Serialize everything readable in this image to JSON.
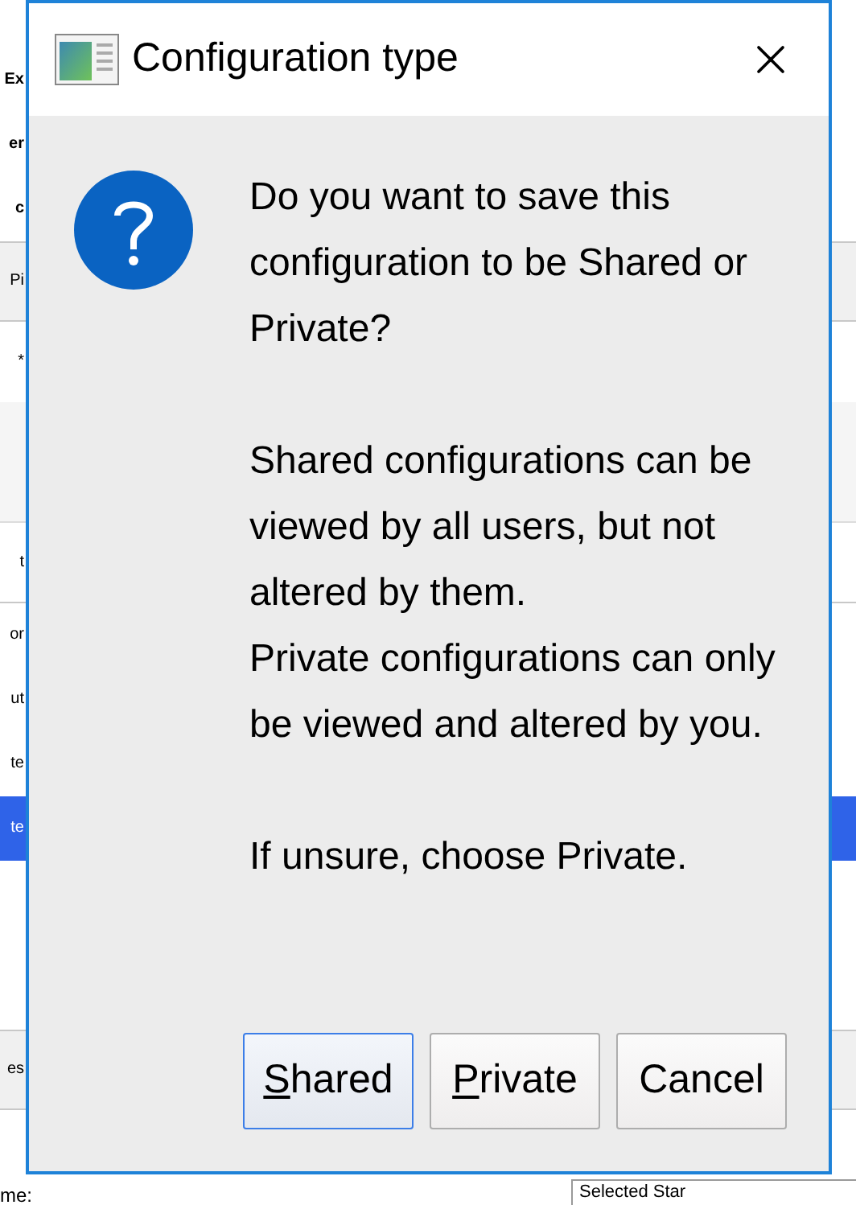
{
  "background": {
    "headings": [
      "Ex",
      "er",
      "c"
    ],
    "tab": "Pi",
    "marker": "*",
    "column_header": "t",
    "rows": [
      {
        "text": "or",
        "selected": false
      },
      {
        "text": "ut",
        "selected": false
      },
      {
        "text": "te",
        "selected": false
      },
      {
        "text": "te",
        "selected": true
      }
    ],
    "section": "es",
    "label": "me:",
    "field_value": "Selected Star"
  },
  "dialog": {
    "title": "Configuration type",
    "message": [
      [
        "Do you want to save this configuration to be Shared or Private?"
      ],
      [
        "Shared configurations can be viewed by all users, but not altered by them.",
        "Private configurations can only be viewed and altered by you."
      ],
      [
        "If unsure, choose Private."
      ]
    ],
    "buttons": [
      {
        "mnemonic": "S",
        "label": "hared",
        "default": true
      },
      {
        "mnemonic": "P",
        "label": "rivate",
        "default": false
      },
      {
        "label": "Cancel",
        "default": false
      }
    ]
  }
}
